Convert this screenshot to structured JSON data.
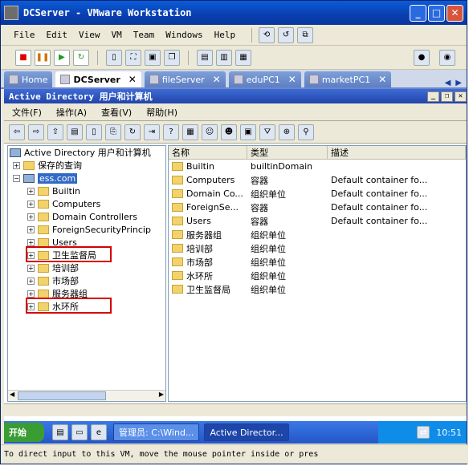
{
  "window": {
    "title": "DCServer - VMware Workstation"
  },
  "vm_menu": [
    "File",
    "Edit",
    "View",
    "VM",
    "Team",
    "Windows",
    "Help"
  ],
  "tabs": [
    {
      "label": "Home",
      "active": false
    },
    {
      "label": "DCServer",
      "active": true
    },
    {
      "label": "fileServer",
      "active": false
    },
    {
      "label": "eduPC1",
      "active": false
    },
    {
      "label": "marketPC1",
      "active": false
    }
  ],
  "aduc": {
    "title": "Active Directory 用户和计算机",
    "menu": [
      "文件(F)",
      "操作(A)",
      "查看(V)",
      "帮助(H)"
    ]
  },
  "tree": {
    "root": "Active Directory 用户和计算机",
    "saved_queries": "保存的查询",
    "domain": "ess.com",
    "children": [
      "Builtin",
      "Computers",
      "Domain Controllers",
      "ForeignSecurityPrincip",
      "Users",
      "卫生监督局",
      "培训部",
      "市场部",
      "服务器组",
      "水环所"
    ]
  },
  "list": {
    "columns": [
      "名称",
      "类型",
      "描述"
    ],
    "rows": [
      {
        "name": "Builtin",
        "type": "builtinDomain",
        "desc": ""
      },
      {
        "name": "Computers",
        "type": "容器",
        "desc": "Default container fo..."
      },
      {
        "name": "Domain Co...",
        "type": "组织单位",
        "desc": "Default container fo..."
      },
      {
        "name": "ForeignSe...",
        "type": "容器",
        "desc": "Default container fo..."
      },
      {
        "name": "Users",
        "type": "容器",
        "desc": "Default container fo..."
      },
      {
        "name": "服务器组",
        "type": "组织单位",
        "desc": ""
      },
      {
        "name": "培训部",
        "type": "组织单位",
        "desc": ""
      },
      {
        "name": "市场部",
        "type": "组织单位",
        "desc": ""
      },
      {
        "name": "水环所",
        "type": "组织单位",
        "desc": ""
      },
      {
        "name": "卫生监督局",
        "type": "组织单位",
        "desc": ""
      }
    ]
  },
  "taskbar": {
    "start": "开始",
    "tasks": [
      "管理员: C:\\Wind...",
      "Active Director..."
    ],
    "clock": "10:51"
  },
  "status": "To direct input to this VM, move the mouse pointer inside or pres"
}
